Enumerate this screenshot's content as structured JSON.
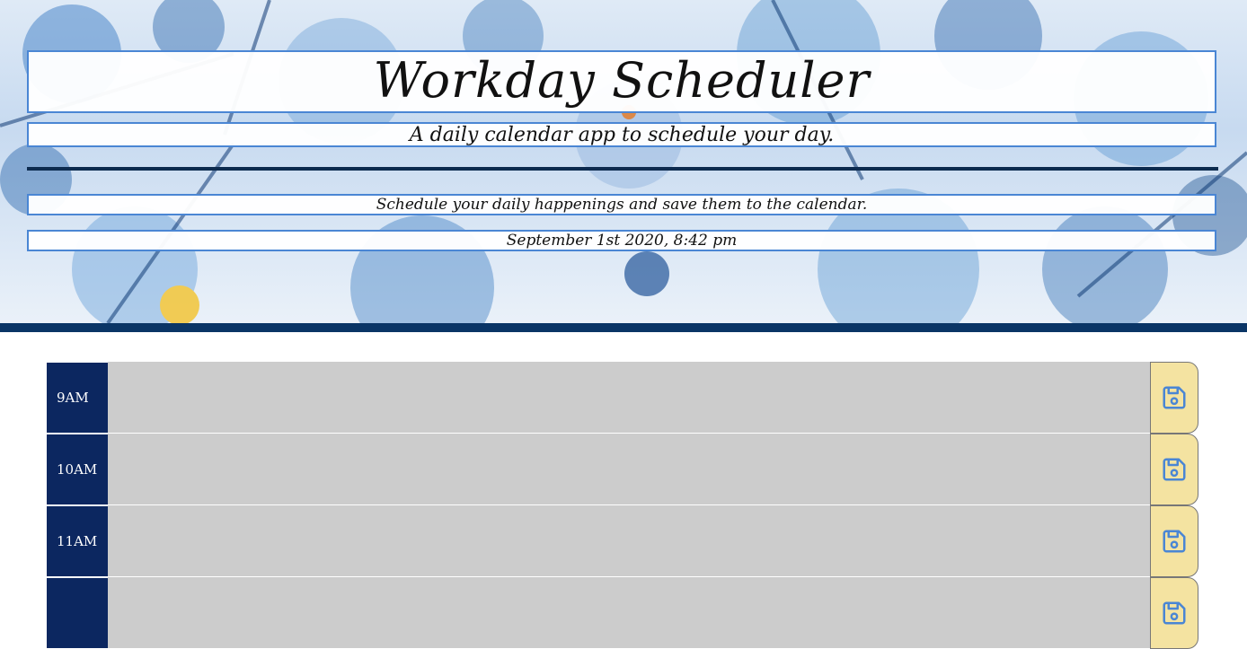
{
  "header": {
    "title": "Workday Scheduler",
    "subtitle": "A daily calendar app to schedule your day.",
    "lead": "Schedule your daily happenings and save them to the calendar.",
    "current_day": "September 1st 2020, 8:42 pm"
  },
  "rows": [
    {
      "hour": "9AM",
      "text": ""
    },
    {
      "hour": "10AM",
      "text": ""
    },
    {
      "hour": "11AM",
      "text": ""
    },
    {
      "hour": "",
      "text": ""
    }
  ],
  "icons": {
    "save": "floppy-disk-icon"
  },
  "colors": {
    "hour_bg": "#0c2760",
    "past_bg": "#cccccc",
    "save_bg": "#f4e3a1",
    "save_icon": "#4a86d4",
    "band_border": "#4a86d4",
    "divider": "#0d2b4f",
    "jumbo_bottom": "#0a3566"
  }
}
